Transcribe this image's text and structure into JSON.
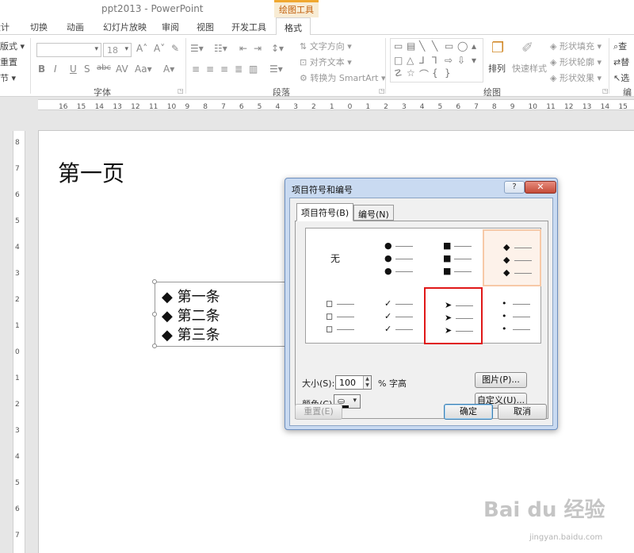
{
  "window": {
    "app_title": "ppt2013 - PowerPoint",
    "context_group": "绘图工具"
  },
  "tabs": [
    {
      "label": "设计"
    },
    {
      "label": "切换"
    },
    {
      "label": "动画"
    },
    {
      "label": "幻灯片放映"
    },
    {
      "label": "审阅"
    },
    {
      "label": "视图"
    },
    {
      "label": "开发工具"
    },
    {
      "label": "格式"
    }
  ],
  "ribbon": {
    "slides": {
      "layout": "版式",
      "reset": "重置",
      "section": "节"
    },
    "font": {
      "label": "字体",
      "size": "18"
    },
    "paragraph": {
      "label": "段落",
      "text_direction": "文字方向",
      "align_text": "对齐文本",
      "smartart": "转换为 SmartArt"
    },
    "drawing": {
      "label": "绘图",
      "arrange": "排列",
      "quick_styles": "快速样式",
      "shape_fill": "形状填充",
      "shape_outline": "形状轮廓",
      "shape_effects": "形状效果"
    },
    "editing": {
      "find": "查",
      "replace": "替",
      "select": "选",
      "label": "编"
    }
  },
  "slide": {
    "title": "第一页",
    "bullets": [
      "第一条",
      "第二条",
      "第三条"
    ],
    "bullet_symbol": "◆"
  },
  "dialog": {
    "title": "项目符号和编号",
    "help": "?",
    "close": "✕",
    "tabs": [
      {
        "label": "项目符号(B)"
      },
      {
        "label": "编号(N)"
      }
    ],
    "none_label": "无",
    "options": [
      {
        "symbol": "",
        "state": "normal"
      },
      {
        "symbol": "●",
        "state": "normal"
      },
      {
        "symbol": "■",
        "state": "normal"
      },
      {
        "symbol": "◆",
        "state": "selected"
      },
      {
        "symbol": "◻",
        "state": "normal"
      },
      {
        "symbol": "✓",
        "state": "normal"
      },
      {
        "symbol": "➤",
        "state": "highlight"
      },
      {
        "symbol": "•",
        "state": "normal"
      }
    ],
    "size_label": "大小(S):",
    "size_value": "100",
    "size_unit": "% 字高",
    "color_label": "颜色(C)",
    "picture_btn": "图片(P)...",
    "customize_btn": "自定义(U)...",
    "reset_btn": "重置(E)",
    "ok_btn": "确定",
    "cancel_btn": "取消"
  },
  "ruler": {
    "h_ticks": [
      "16",
      "15",
      "14",
      "13",
      "12",
      "11",
      "10",
      "9",
      "8",
      "7",
      "6",
      "5",
      "4",
      "3",
      "2",
      "1",
      "0",
      "1",
      "2",
      "3",
      "4",
      "5",
      "6",
      "7",
      "8",
      "9",
      "10",
      "11",
      "12",
      "13",
      "14",
      "15",
      "16"
    ],
    "v_ticks": [
      "8",
      "7",
      "6",
      "5",
      "4",
      "3",
      "2",
      "1",
      "0",
      "1",
      "2",
      "3",
      "4",
      "5",
      "6",
      "7"
    ]
  },
  "watermark": {
    "logo": "Bai du 经验",
    "url": "jingyan.baidu.com"
  }
}
